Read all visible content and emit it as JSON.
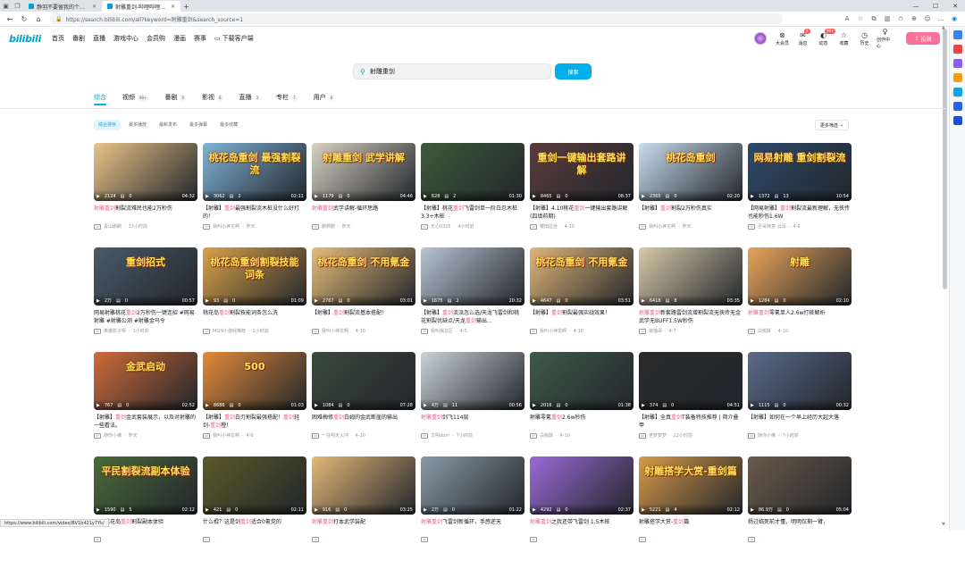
{
  "browser": {
    "tabs": [
      {
        "title": "静羽不要留我的个人空间-静羽"
      },
      {
        "title": "射雕重剑-哔哩哔哩_Bilibili"
      }
    ],
    "url": "https://search.bilibili.com/all?keyword=射雕重剑&search_source=1",
    "status_url": "https://www.bilibili.com/video/BV1b421y7Yk/"
  },
  "nav": {
    "logo": "bilibili",
    "links": [
      "首页",
      "番剧",
      "直播",
      "游戏中心",
      "会员购",
      "漫画",
      "赛事"
    ],
    "download": "下载客户端",
    "right": [
      {
        "label": "大会员",
        "icon": "vip-icon",
        "badge": ""
      },
      {
        "label": "消息",
        "icon": "message-icon",
        "badge": "2"
      },
      {
        "label": "动态",
        "icon": "dynamic-icon",
        "badge": "99+"
      },
      {
        "label": "收藏",
        "icon": "favorite-icon",
        "badge": ""
      },
      {
        "label": "历史",
        "icon": "history-icon",
        "badge": ""
      },
      {
        "label": "创作中心",
        "icon": "creator-icon",
        "badge": ""
      }
    ],
    "upload": "投稿"
  },
  "search": {
    "query": "射雕重剑",
    "button": "搜索"
  },
  "tabs": [
    {
      "label": "综合",
      "count": ""
    },
    {
      "label": "视频",
      "count": "99+"
    },
    {
      "label": "番剧",
      "count": "0"
    },
    {
      "label": "影视",
      "count": "8"
    },
    {
      "label": "直播",
      "count": "3"
    },
    {
      "label": "专栏",
      "count": "7"
    },
    {
      "label": "用户",
      "count": "8"
    }
  ],
  "sorts": [
    "综合排序",
    "最多播放",
    "最新发布",
    "最多弹幕",
    "最多收藏"
  ],
  "more_filter": "更多筛选",
  "videos": [
    {
      "views": "2124",
      "danmaku": "0",
      "duration": "04:32",
      "title": "射雕重剑割裂流难民也能2万秒伤",
      "author": "青山刷刷",
      "date": "13小时前",
      "bg": "#e9c48a",
      "caption": ""
    },
    {
      "views": "3062",
      "danmaku": "2",
      "duration": "02:11",
      "title": "【射雕】重剑最强割裂流木桩没什么好打的！",
      "author": "我叫小神龙啊",
      "date": "昨天",
      "bg": "#7fb3d6",
      "caption": "桃花岛重剑 最强割裂流"
    },
    {
      "views": "1179",
      "danmaku": "0",
      "duration": "04:46",
      "title": "射雕重剑武学讲解-循环思路",
      "author": "鹏啊鹏",
      "date": "昨天",
      "bg": "#d8d2c4",
      "caption": "射雕重剑 武学讲解"
    },
    {
      "views": "628",
      "danmaku": "2",
      "duration": "01:30",
      "title": "【射雕】桃花重剑飞雷剑单一阶白忍木桩3.3+木桩",
      "author": "无心0325",
      "date": "4小时前",
      "bg": "#3d5a3a",
      "caption": ""
    },
    {
      "views": "8465",
      "danmaku": "0",
      "duration": "08:37",
      "title": "【射雕】4.10桃花重剑一键输出套路讲解(四填前期)",
      "author": "櫻田拉丝",
      "date": "4-10",
      "bg": "#5a3c3c",
      "caption": "重剑一键输出套路讲解"
    },
    {
      "views": "2365",
      "danmaku": "0",
      "duration": "02:20",
      "title": "【射雕】重剑割裂2万秒伤真实",
      "author": "我叫小神龙啊",
      "date": "昨天",
      "bg": "#c8dced",
      "caption": "桃花岛重剑"
    },
    {
      "views": "1372",
      "danmaku": "13",
      "duration": "10:54",
      "title": "【网易射雕】重剑割裂流最新理解，无侠传也能秒伤1.6W",
      "author": "丞哥随意-云泽",
      "date": "4-6",
      "bg": "#2e4a6b",
      "caption": "网易射雕 重剑割裂流"
    },
    {
      "views": "2万",
      "danmaku": "0",
      "duration": "00:57",
      "title": "网易射雕桃花重剑2万秒伤一键连招 #网易射雕 #射雕公测 #射雕金乌令",
      "author": "英雄影子呀",
      "date": "1小时前",
      "bg": "#4a5a6a",
      "caption": "重剑招式"
    },
    {
      "views": "93",
      "danmaku": "0",
      "duration": "01:09",
      "title": "桃花岛重剑割裂技能词条怎么洗",
      "author": "MGN小游戏推荐",
      "date": "1小时前",
      "bg": "#d9a24a",
      "caption": "桃花岛重剑割裂技能词条"
    },
    {
      "views": "2767",
      "danmaku": "0",
      "duration": "03:01",
      "title": "【射雕】重剑割裂流基本搭配！",
      "author": "我叫小神龙啊",
      "date": "4-10",
      "bg": "#e6bd7a",
      "caption": "桃花岛重剑 不用氪金"
    },
    {
      "views": "1675",
      "danmaku": "2",
      "duration": "20:32",
      "title": "【射雕】重剑流派怎么选/天龙飞雷剑和桃花割裂优缺点/天龙重剑输出...",
      "author": "我叫我总区",
      "date": "4-5",
      "bg": "#b8c4d4",
      "caption": ""
    },
    {
      "views": "4647",
      "danmaku": "0",
      "duration": "03:51",
      "title": "【射雕】重剑割裂最强实战效果！",
      "author": "我叫小神龙啊",
      "date": "4-10",
      "bg": "#e1b67a",
      "caption": "桃花岛重剑 不用氪金"
    },
    {
      "views": "6418",
      "danmaku": "8",
      "duration": "03:35",
      "title": "射雕重剑新套路雷剑流增割裂流无侠传无金武学无BUFF1.5W秒伤",
      "author": "夜猫哥",
      "date": "4-7",
      "bg": "#d6c9a8",
      "caption": ""
    },
    {
      "views": "1284",
      "danmaku": "0",
      "duration": "02:10",
      "title": "射雕重剑零氪单人2.6w打桩解析",
      "author": "白桃酥",
      "date": "4-10",
      "bg": "#e8a45a",
      "caption": "射雕"
    },
    {
      "views": "767",
      "danmaku": "0",
      "duration": "02:52",
      "title": "【射雕】重剑金武套装展示，以及对射雕的一些看法。",
      "author": "随你小佛",
      "date": "昨天",
      "bg": "#cf6a3a",
      "caption": "金武启动"
    },
    {
      "views": "8686",
      "danmaku": "0",
      "duration": "01:03",
      "title": "【射雕】重剑白刃割裂最强搭配！重剑轻剑-重剑橙！",
      "author": "我叫小神龙啊",
      "date": "4-6",
      "bg": "#e38a3a",
      "caption": "500"
    },
    {
      "views": "1084",
      "danmaku": "0",
      "duration": "07:28",
      "title": "困难梅修重剑白姆的金武断崖的输出",
      "author": "一往明天火冲",
      "date": "4-10",
      "bg": "#3a4a3e",
      "caption": ""
    },
    {
      "views": "4万",
      "danmaku": "11",
      "duration": "00:56",
      "title": "射雕重剑剑飞114层",
      "author": "文明dom",
      "date": "7小时前",
      "bg": "#c9d3d6",
      "caption": ""
    },
    {
      "views": "2016",
      "danmaku": "0",
      "duration": "01:38",
      "title": "射雕零氪重剑2.6w秒伤",
      "author": "白桃酥",
      "date": "4-10",
      "bg": "#3f5a4a",
      "caption": ""
    },
    {
      "views": "374",
      "danmaku": "0",
      "duration": "04:51",
      "title": "【射雕】全真重剑T装备特技推荐 | 简介叠甲",
      "author": "老梦梦梦",
      "date": "22小时前",
      "bg": "#2a2a2a",
      "caption": ""
    },
    {
      "views": "1115",
      "danmaku": "0",
      "duration": "00:32",
      "title": "【射雕】如何在一个早上经历大起大落",
      "author": "随你小佛",
      "date": "7小时前",
      "bg": "#5a6a8a",
      "caption": ""
    },
    {
      "views": "1590",
      "danmaku": "5",
      "duration": "02:12",
      "title": "平民桃花岛重剑割裂副本体验",
      "author": "",
      "date": "",
      "bg": "#4a6a3a",
      "caption": "平民割裂流副本体验"
    },
    {
      "views": "421",
      "danmaku": "0",
      "duration": "02:11",
      "title": "什么棍？这是剑重剑适合0氪党的",
      "author": "",
      "date": "",
      "bg": "#5a5a2a",
      "caption": ""
    },
    {
      "views": "916",
      "danmaku": "0",
      "duration": "03:25",
      "title": "射雕重剑打本武学装配",
      "author": "",
      "date": "",
      "bg": "#e4b878",
      "caption": ""
    },
    {
      "views": "2万",
      "danmaku": "0",
      "duration": "01:22",
      "title": "射雕重剑飞雷剑新循环，手感逆天",
      "author": "",
      "date": "",
      "bg": "#8a9aa6",
      "caption": ""
    },
    {
      "views": "4292",
      "danmaku": "0",
      "duration": "02:37",
      "title": "射雕重剑之我还带飞雷剑 1.5木桩",
      "author": "",
      "date": "",
      "bg": "#9a6ad6",
      "caption": ""
    },
    {
      "views": "5221",
      "danmaku": "4",
      "duration": "02:12",
      "title": "射雕搭学大赏-重剑篇",
      "author": "",
      "date": "",
      "bg": "#d69a4a",
      "caption": "射雕搭学大赏-重剑篇"
    },
    {
      "views": "86.9万",
      "danmaku": "0",
      "duration": "05:04",
      "title": "杨过临死前才懂，明明仅剩一臂，",
      "author": "",
      "date": "",
      "bg": "#6a5a4a",
      "caption": ""
    }
  ]
}
